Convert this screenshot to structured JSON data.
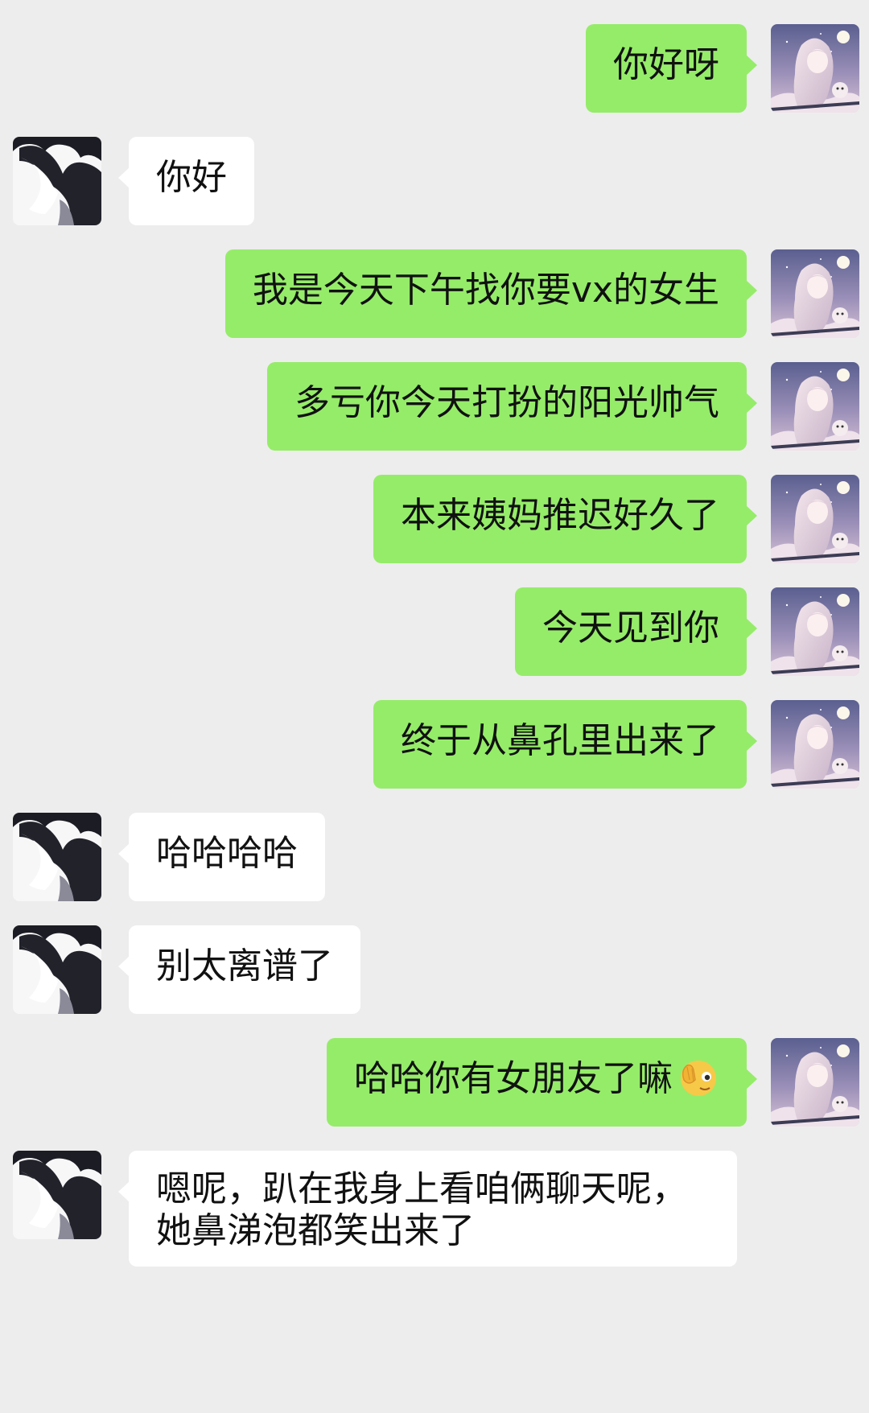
{
  "chat": {
    "messages": [
      {
        "sender": "me",
        "text": "你好呀"
      },
      {
        "sender": "them",
        "text": "你好"
      },
      {
        "sender": "me",
        "text": "我是今天下午找你要vx的女生"
      },
      {
        "sender": "me",
        "text": "多亏你今天打扮的阳光帅气"
      },
      {
        "sender": "me",
        "text": "本来姨妈推迟好久了"
      },
      {
        "sender": "me",
        "text": "今天见到你"
      },
      {
        "sender": "me",
        "text": "终于从鼻孔里出来了"
      },
      {
        "sender": "them",
        "text": "哈哈哈哈"
      },
      {
        "sender": "them",
        "text": "别太离谱了"
      },
      {
        "sender": "me",
        "text": "哈哈你有女朋友了嘛",
        "emoji": "facepalm-peek-emoji"
      },
      {
        "sender": "them",
        "lines": [
          "嗯呢，趴在我身上看咱俩聊天呢，",
          "她鼻涕泡都笑出来了"
        ]
      }
    ]
  },
  "colors": {
    "background": "#ededed",
    "my_bubble": "#95ec69",
    "their_bubble": "#ffffff",
    "text": "#111111"
  },
  "icons": {
    "my_avatar": "anime-girl-night-sky-avatar",
    "their_avatar": "anime-boy-silhouette-avatar"
  }
}
